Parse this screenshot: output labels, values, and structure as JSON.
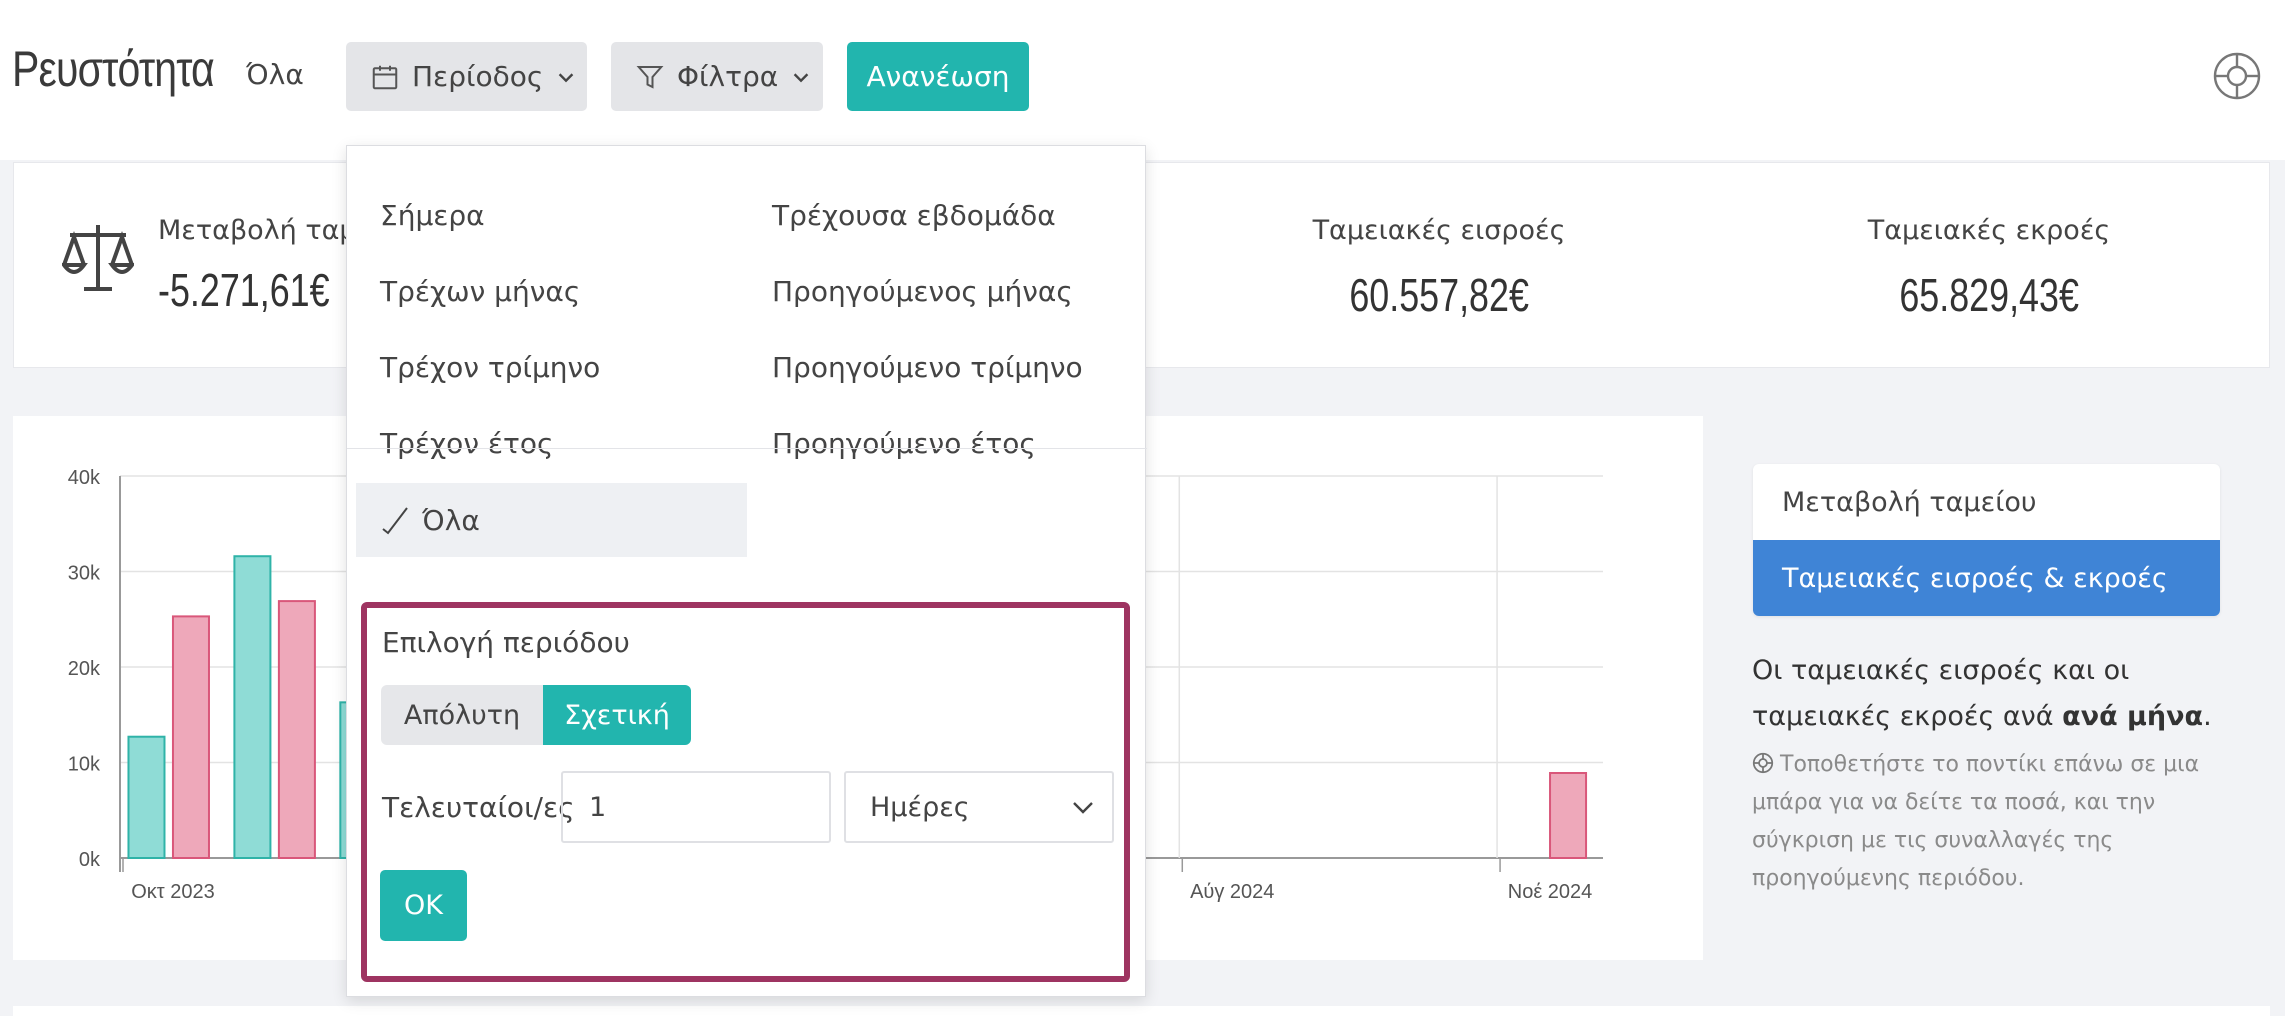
{
  "header": {
    "title": "Ρευστότητα",
    "current_period": "Όλα",
    "period_button": "Περίοδος",
    "filters_button": "Φίλτρα",
    "refresh_button": "Ανανέωση"
  },
  "kpis": {
    "cash_change_label": "Μεταβολή ταμ",
    "cash_change_value": "-5.271,61€",
    "inflows_label": "Ταμειακές εισροές",
    "inflows_value": "60.557,82€",
    "outflows_label": "Ταμειακές εκροές",
    "outflows_value": "65.829,43€"
  },
  "dropdown": {
    "options_col1": [
      "Σήμερα",
      "Τρέχων μήνας",
      "Τρέχον τρίμηνο",
      "Τρέχον έτος"
    ],
    "options_col2": [
      "Τρέχουσα εβδομάδα",
      "Προηγούμενος μήνας",
      "Προηγούμενο τρίμηνο",
      "Προηγούμενο έτος"
    ],
    "selected_option": "Όλα",
    "period_box": {
      "title": "Επιλογή περιόδου",
      "absolute_label": "Απόλυτη",
      "relative_label": "Σχετική",
      "active_mode": "Σχετική",
      "last_label": "Τελευταίοι/ες",
      "last_value": "1",
      "unit_value": "Ημέρες",
      "ok_label": "OK"
    }
  },
  "side_panel": {
    "tabs": [
      "Μεταβολή ταμείου",
      "Ταμειακές εισροές & εκροές"
    ],
    "active_tab": "Ταμειακές εισροές & εκροές",
    "description_prefix": "Οι ταμειακές εισροές και οι ταμειακές εκροές ανά ",
    "description_bold": "ανά μήνα",
    "description_suffix": ".",
    "hint": "Τοποθετήστε το ποντίκι επάνω σε μια μπάρα για να δείτε τα ποσά, και την σύγκριση με τις συναλλαγές της προηγούμενης περιόδου."
  },
  "colors": {
    "accent": "#22b5ae",
    "active_tab": "#3f84d6",
    "inflow_fill": "#8fdcd6",
    "inflow_stroke": "#2fb3a8",
    "outflow_fill": "#eea8ba",
    "outflow_stroke": "#d9577a",
    "highlight_border": "#9e3461"
  },
  "chart_data": {
    "type": "bar",
    "y_ticks": [
      "0k",
      "10k",
      "20k",
      "30k",
      "40k"
    ],
    "x_tick_labels": [
      "Οκτ 2023",
      "Αύγ 2024",
      "Νοέ 2024"
    ],
    "ylim": [
      0,
      40000
    ],
    "series": [
      {
        "name": "Ταμειακές εισροές",
        "bars": [
          {
            "x": "Οκτ 2023",
            "value": 12700
          },
          {
            "x": "Νοέ 2023",
            "value": 31600
          },
          {
            "x": "Δεκ 2023",
            "value": 16300
          }
        ]
      },
      {
        "name": "Ταμειακές εκροές",
        "bars": [
          {
            "x": "Οκτ 2023",
            "value": 25300
          },
          {
            "x": "Νοέ 2023",
            "value": 26900
          },
          {
            "x": "Νοέ 2024",
            "value": 8900
          }
        ]
      }
    ]
  }
}
